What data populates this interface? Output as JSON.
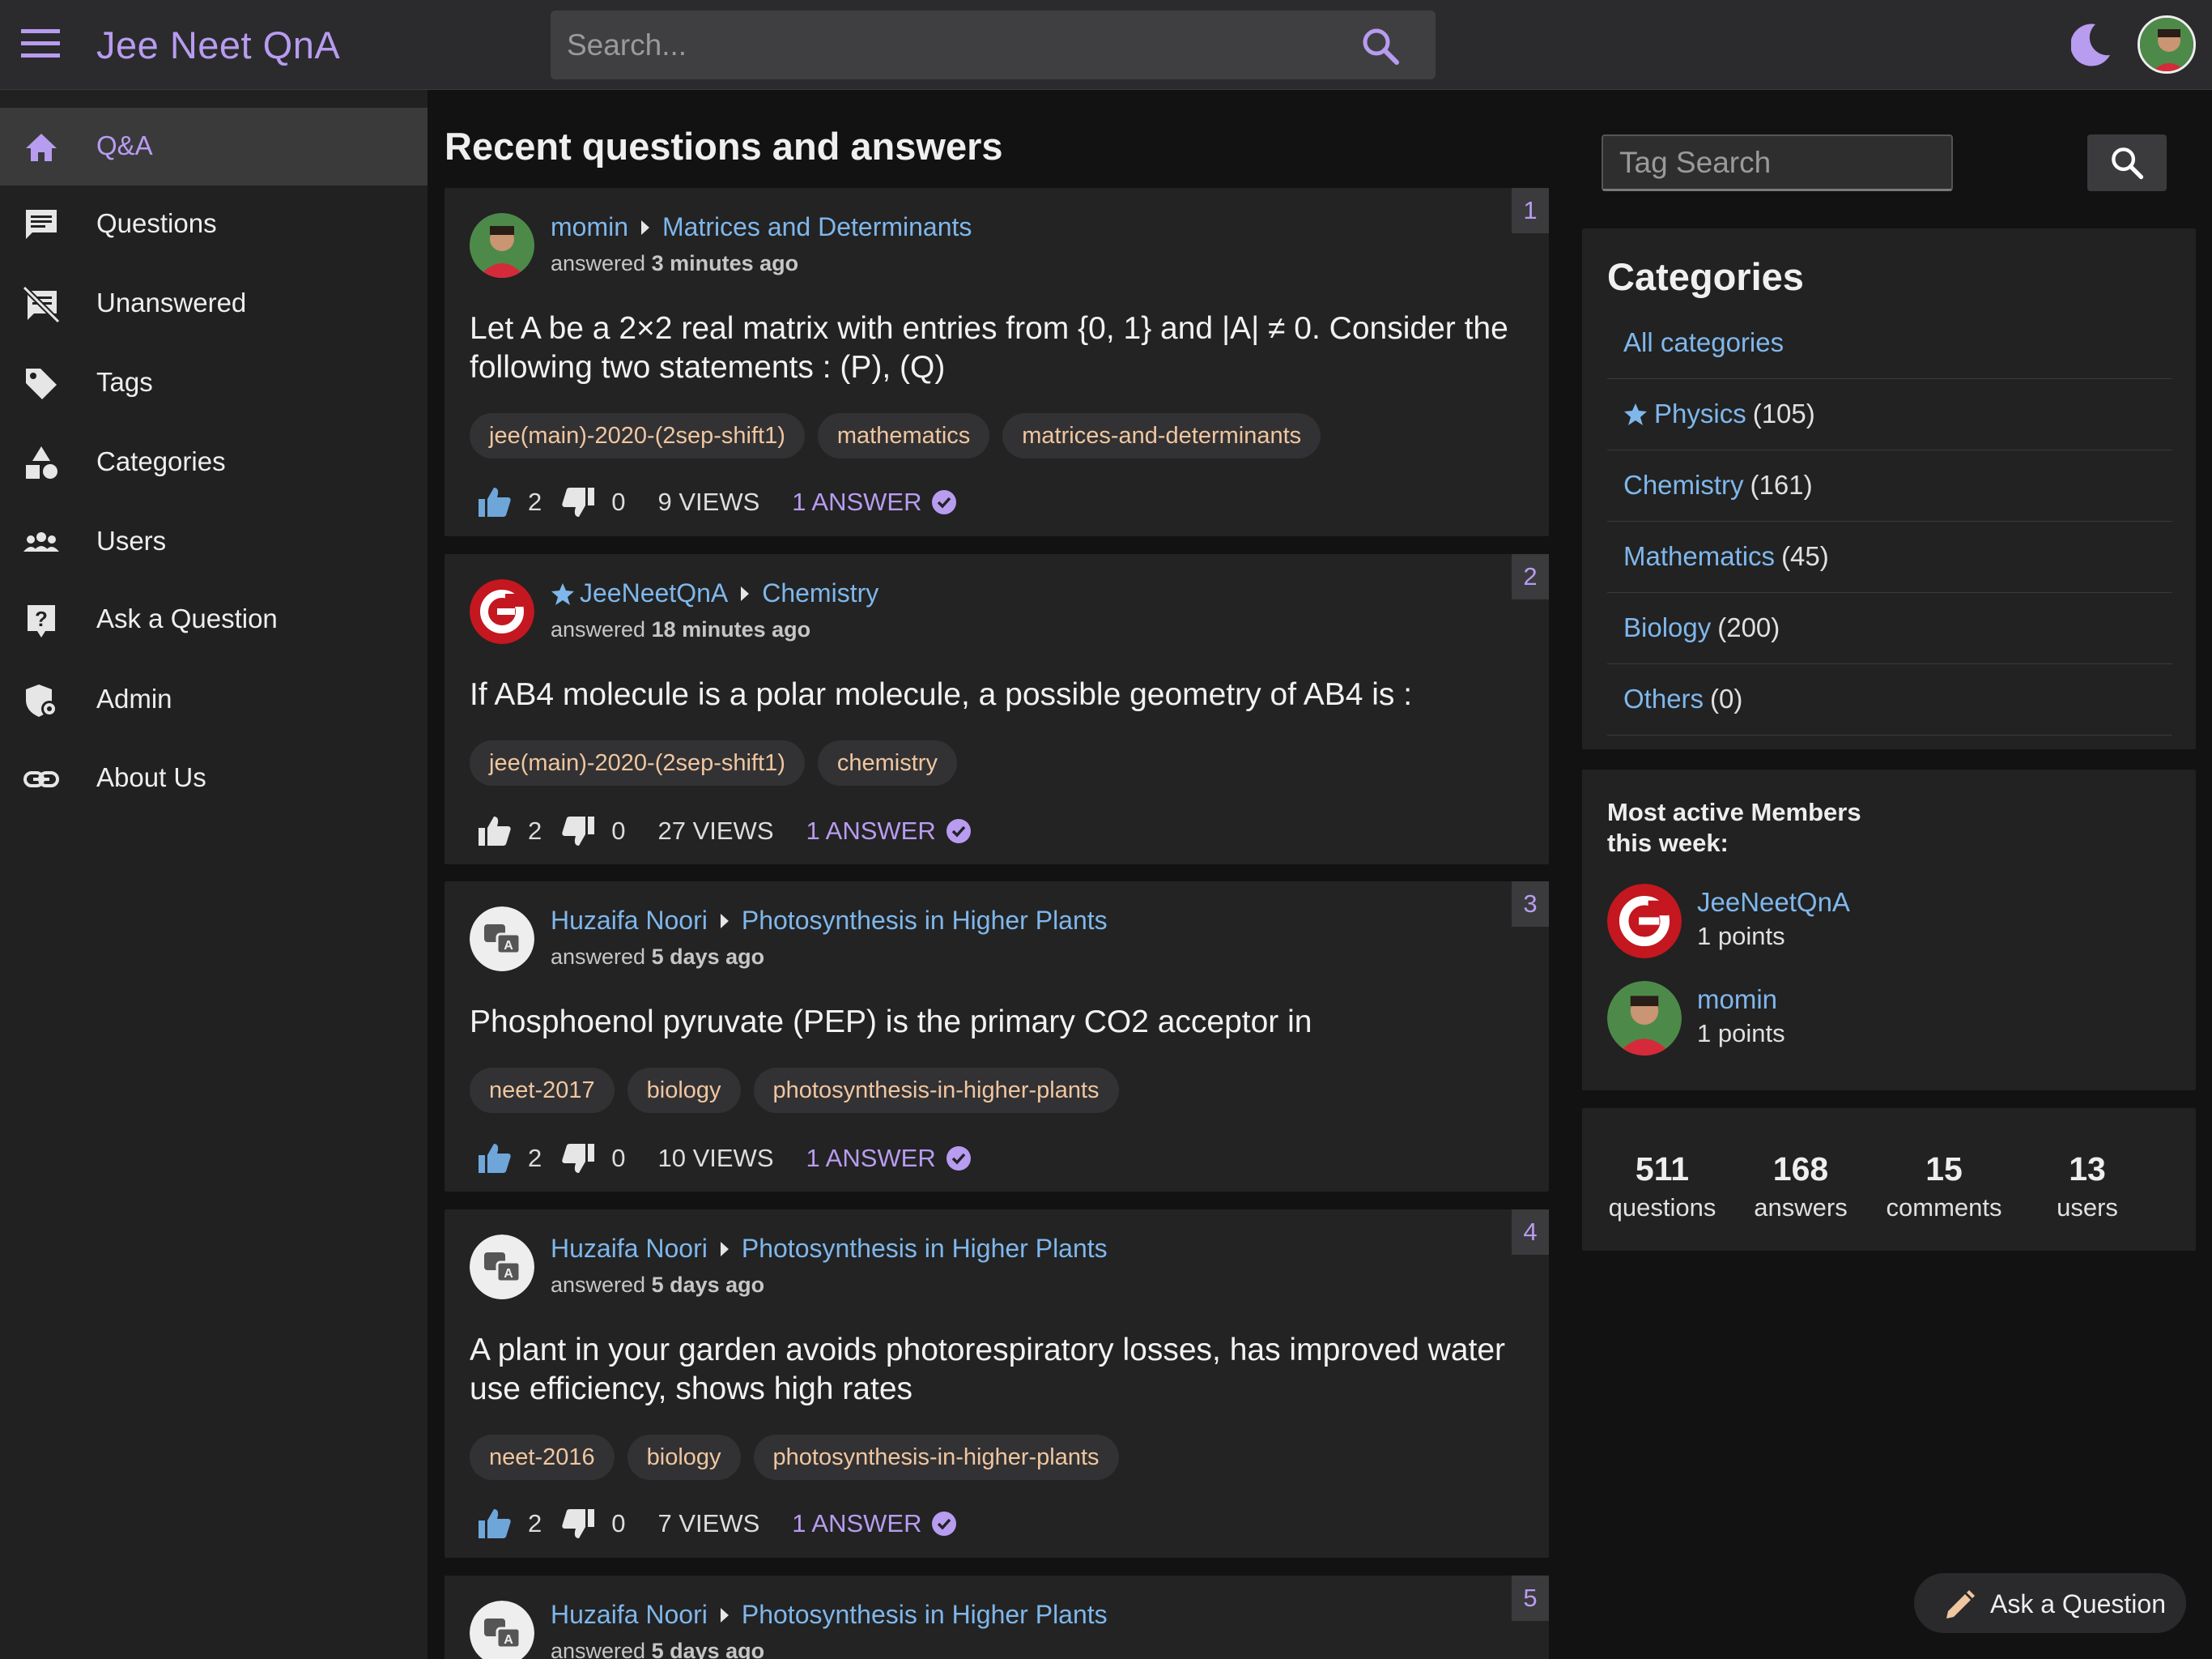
{
  "header": {
    "title": "Jee Neet QnA",
    "search_placeholder": "Search..."
  },
  "sidebar": {
    "items": [
      {
        "label": "Q&A",
        "icon": "home-icon",
        "active": true
      },
      {
        "label": "Questions",
        "icon": "chat-icon"
      },
      {
        "label": "Unanswered",
        "icon": "chat-off-icon"
      },
      {
        "label": "Tags",
        "icon": "tag-icon"
      },
      {
        "label": "Categories",
        "icon": "shapes-icon"
      },
      {
        "label": "Users",
        "icon": "users-icon"
      },
      {
        "label": "Ask a Question",
        "icon": "question-icon"
      },
      {
        "label": "Admin",
        "icon": "shield-icon"
      },
      {
        "label": "About Us",
        "icon": "link-icon"
      }
    ]
  },
  "main": {
    "title": "Recent questions and answers",
    "questions": [
      {
        "num": "1",
        "user": "momin",
        "category": "Matrices and Determinants",
        "action": "answered",
        "time": "3 minutes ago",
        "title": "Let A be a 2×2 real matrix with entries from {0, 1} and |A| ≠ 0. Consider the following two statements : (P), (Q)",
        "tags": [
          "jee(main)-2020-(2sep-shift1)",
          "mathematics",
          "matrices-and-determinants"
        ],
        "up": "2",
        "down": "0",
        "views": "9 VIEWS",
        "answers": "1 ANSWER"
      },
      {
        "num": "2",
        "user": "JeeNeetQnA",
        "category": "Chemistry",
        "action": "answered",
        "time": "18 minutes ago",
        "title": "If AB4 molecule is a polar molecule, a possible geometry of AB4 is :",
        "tags": [
          "jee(main)-2020-(2sep-shift1)",
          "chemistry"
        ],
        "up": "2",
        "down": "0",
        "views": "27 VIEWS",
        "answers": "1 ANSWER"
      },
      {
        "num": "3",
        "user": "Huzaifa Noori",
        "category": "Photosynthesis in Higher Plants",
        "action": "answered",
        "time": "5 days ago",
        "title": "Phosphoenol pyruvate (PEP) is the primary CO2 acceptor in",
        "tags": [
          "neet-2017",
          "biology",
          "photosynthesis-in-higher-plants"
        ],
        "up": "2",
        "down": "0",
        "views": "10 VIEWS",
        "answers": "1 ANSWER"
      },
      {
        "num": "4",
        "user": "Huzaifa Noori",
        "category": "Photosynthesis in Higher Plants",
        "action": "answered",
        "time": "5 days ago",
        "title": "A plant in your garden avoids photorespiratory losses, has improved water use efficiency, shows high rates",
        "tags": [
          "neet-2016",
          "biology",
          "photosynthesis-in-higher-plants"
        ],
        "up": "2",
        "down": "0",
        "views": "7 VIEWS",
        "answers": "1 ANSWER"
      },
      {
        "num": "5",
        "user": "Huzaifa Noori",
        "category": "Photosynthesis in Higher Plants",
        "action": "answered",
        "time": "5 days ago"
      }
    ]
  },
  "right": {
    "tag_search_placeholder": "Tag Search",
    "categories_title": "Categories",
    "categories": [
      {
        "name": "All categories",
        "count": ""
      },
      {
        "name": "Physics",
        "count": "(105)"
      },
      {
        "name": "Chemistry",
        "count": "(161)"
      },
      {
        "name": "Mathematics",
        "count": "(45)"
      },
      {
        "name": "Biology",
        "count": "(200)"
      },
      {
        "name": "Others",
        "count": "(0)"
      }
    ],
    "members_title_1": "Most active Members",
    "members_title_2": "this week:",
    "members": [
      {
        "name": "JeeNeetQnA",
        "points": "1 points"
      },
      {
        "name": "momin",
        "points": "1 points"
      }
    ],
    "stats": [
      {
        "value": "511",
        "label": "questions"
      },
      {
        "value": "168",
        "label": "answers"
      },
      {
        "value": "15",
        "label": "comments"
      },
      {
        "value": "13",
        "label": "users"
      }
    ],
    "ask_button": "Ask a Question"
  },
  "colors": {
    "accent": "#b89cf0",
    "link": "#7fb7ec",
    "tag_text": "#f0c6a0",
    "thumb": "#6fa6da"
  }
}
